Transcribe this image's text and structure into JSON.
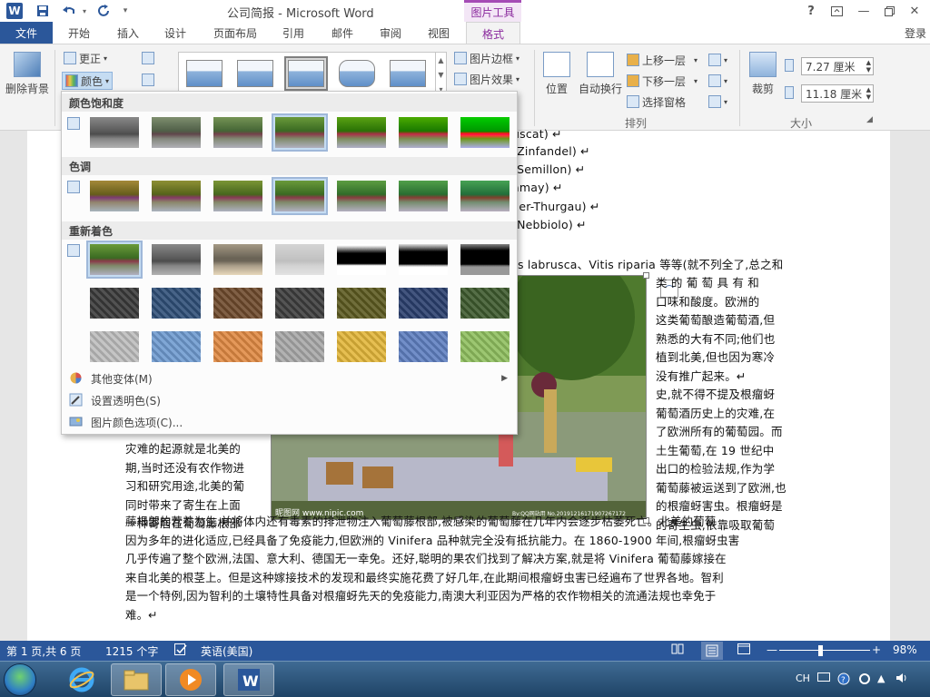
{
  "titlebar": {
    "title": "公司简报 - Microsoft Word",
    "tools_header": "图片工具",
    "quick_access": [
      "save-icon",
      "undo-icon",
      "redo-icon",
      "customize-icon"
    ],
    "window_controls": [
      "help-icon",
      "ribbon-display-icon",
      "minimize-icon",
      "restore-icon",
      "close-icon"
    ],
    "help_glyph": "?",
    "minimize_glyph": "—",
    "close_glyph": "✕"
  },
  "tabs": {
    "file": "文件",
    "items": [
      "开始",
      "插入",
      "设计",
      "页面布局",
      "引用",
      "邮件",
      "审阅",
      "视图"
    ],
    "active": "格式",
    "login": "登录"
  },
  "ribbon": {
    "remove_bg": "删除背景",
    "corrections": "更正",
    "color": "颜色",
    "picture_border": "图片边框",
    "picture_effects": "图片效果",
    "position": "位置",
    "wrap_text": "自动换行",
    "bring_forward": "上移一层",
    "send_backward": "下移一层",
    "selection_pane": "选择窗格",
    "arrange_group": "排列",
    "crop": "裁剪",
    "height": "7.27 厘米",
    "width": "11.18 厘米",
    "size_group": "大小"
  },
  "color_menu": {
    "saturation_label": "颜色饱和度",
    "tone_label": "色调",
    "recolor_label": "重新着色",
    "more_variations": "其他变体(M)",
    "set_transparent": "设置透明色(S)",
    "picture_color_options": "图片颜色选项(C)...",
    "recolor_colors": {
      "row2": [
        "#3a3a3a",
        "#2f4f77",
        "#6e4a2c",
        "#3d3d3d",
        "#5c5a20",
        "#2a3f6d",
        "#3e5a2e"
      ],
      "row3": [
        "#bdbdbd",
        "#6f9bd0",
        "#e08a43",
        "#a8a8a8",
        "#e2b63a",
        "#5f7fc0",
        "#8fbf5f"
      ]
    }
  },
  "document": {
    "right_lines": [
      "uscat) ↵",
      "(Zinfandel) ↵",
      "(Semillon) ↵",
      "amay) ↵",
      "ller-Thurgau) ↵",
      "(Nebbiolo) ↵"
    ],
    "line_p1": "s labrusca、Vitis riparia 等等(就不列全了,总之和",
    "wrap_right": [
      "类 的 葡 萄 具 有 和",
      "口味和酸度。欧洲的",
      "这类葡萄酿造葡萄酒,但",
      "熟悉的大有不同;他们也",
      "植到北美,但也因为寒冷",
      "没有推广起来。↵",
      "史,就不得不提及根瘤蚜",
      "葡萄酒历史上的灾难,在",
      "了欧洲所有的葡萄园。而",
      "土生葡萄,在 19 世纪中",
      "出口的检验法规,作为学",
      "葡萄藤被运送到了欧洲,也",
      "的根瘤蚜害虫。根瘤蚜是",
      "的寄生虫,依靠吸取葡萄"
    ],
    "wrap_left": [
      "灾难的起源就是北美的",
      "期,当时还没有农作物进",
      "习和研究用途,北美的葡",
      "同时带来了寄生在上面",
      "一种寄居在葡萄藤根部"
    ],
    "full_lines": [
      "藤根部的营养为生,并将体内还有毒素的排泄物注入葡萄藤根部,被感染的葡萄藤在几年内会逐步枯萎死亡。北美的葡萄",
      "因为多年的进化适应,已经具备了免疫能力,但欧洲的 Vinifera 品种就完全没有抵抗能力。在 1860-1900 年间,根瘤蚜虫害",
      "几乎传遍了整个欧洲,法国、意大利、德国无一幸免。还好,聪明的果农们找到了解决方案,就是将 Vinifera 葡萄藤嫁接在",
      "来自北美的根茎上。但是这种嫁接技术的发现和最终实施花费了好几年,在此期间根瘤蚜虫害已经遍布了世界各地。智利",
      "是一个特例,因为智利的土壤特性具备对根瘤蚜先天的免疫能力,南澳大利亚因为严格的农作物相关的流通法规也幸免于",
      "难。↵"
    ],
    "photo_watermark": "昵图网 www.nipic.com",
    "photo_id": "By:QQ网站用 No.20191216171907267172"
  },
  "status": {
    "page": "第 1 页,共 6 页",
    "words": "1215 个字",
    "language": "英语(美国)",
    "zoom": "98%",
    "zoom_minus": "—",
    "zoom_plus": "+"
  },
  "taskbar": {
    "apps": [
      "start-orb",
      "ie-icon",
      "explorer-icon",
      "media-player-icon",
      "word-icon"
    ],
    "ime": "CH"
  }
}
